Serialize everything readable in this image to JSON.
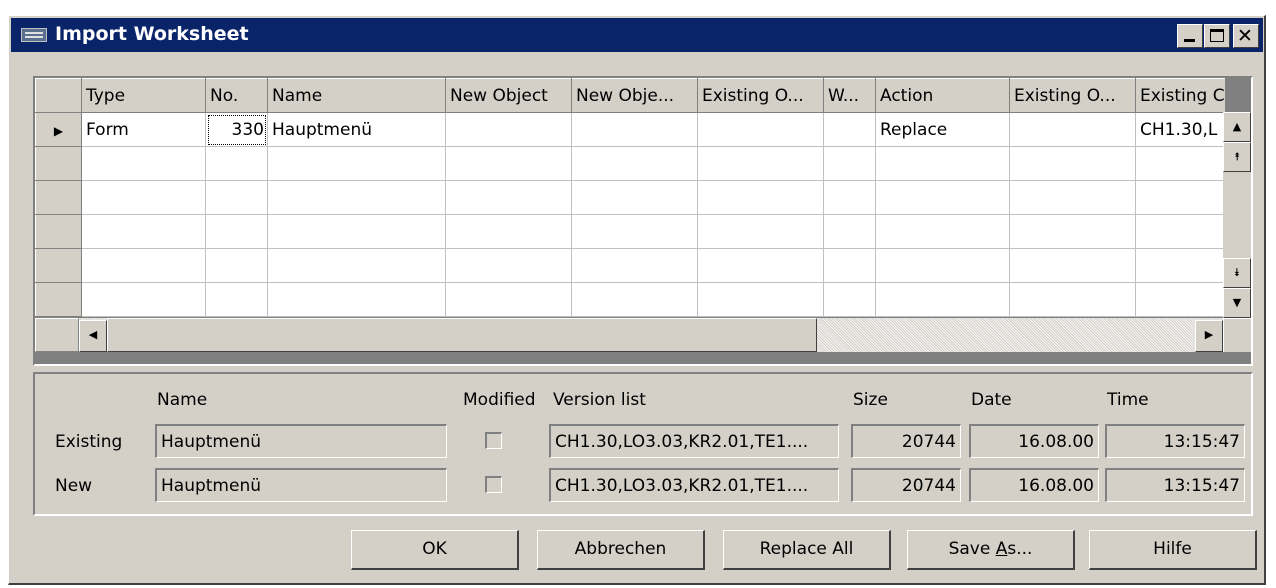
{
  "window": {
    "title": "Import Worksheet"
  },
  "titlebar_icons": [
    "app-icon",
    "minimize-icon",
    "maximize-icon",
    "close-icon"
  ],
  "grid": {
    "columns": [
      "Type",
      "No.",
      "Name",
      "New Object",
      "New Obje...",
      "Existing O...",
      "W...",
      "Action",
      "Existing O...",
      "Existing C"
    ],
    "rows": [
      {
        "type": "Form",
        "no": "330",
        "name": "Hauptmenü",
        "new_object": "",
        "new_obje": "",
        "existing_o": "",
        "w": "",
        "action": "Replace",
        "existing_o2": "",
        "existing_c": "CH1.30,L"
      }
    ],
    "selected_row_marker": "▶"
  },
  "details": {
    "headers": {
      "name": "Name",
      "modified": "Modified",
      "version_list": "Version list",
      "size": "Size",
      "date": "Date",
      "time": "Time"
    },
    "existing": {
      "label": "Existing",
      "name": "Hauptmenü",
      "modified": false,
      "version_list": "CH1.30,LO3.03,KR2.01,TE1....",
      "size": "20744",
      "date": "16.08.00",
      "time": "13:15:47"
    },
    "new": {
      "label": "New",
      "name": "Hauptmenü",
      "modified": false,
      "version_list": "CH1.30,LO3.03,KR2.01,TE1....",
      "size": "20744",
      "date": "16.08.00",
      "time": "13:15:47"
    }
  },
  "buttons": {
    "ok": "OK",
    "cancel": "Abbrechen",
    "replace_all": "Replace All",
    "save_as_prefix": "Save ",
    "save_as_underline": "A",
    "save_as_suffix": "s...",
    "help": "Hilfe"
  }
}
